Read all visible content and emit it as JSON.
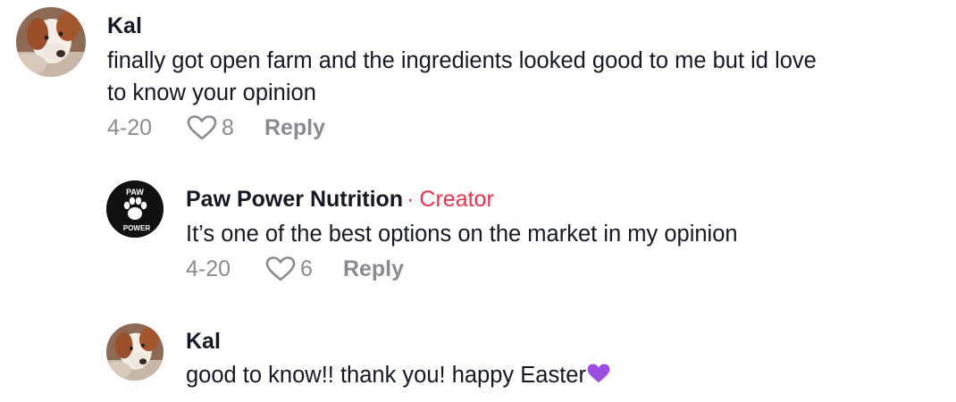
{
  "comments": [
    {
      "username": "Kal",
      "text_line1": "finally got open farm and the ingredients looked good to me but id love",
      "text_line2": "to know your opinion",
      "date": "4-20",
      "likes": "8",
      "reply_label": "Reply",
      "avatar": "dog-avatar"
    },
    {
      "username": "Paw Power Nutrition",
      "separator": "·",
      "badge": "Creator",
      "text": "It’s one of the best options on the market in my opinion",
      "date": "4-20",
      "likes": "6",
      "reply_label": "Reply",
      "avatar": "paw-power-logo",
      "logo_text_top": "PAW",
      "logo_text_bottom": "POWER"
    },
    {
      "username": "Kal",
      "text": "good to know!! thank you! happy Easter",
      "emoji": "purple-heart",
      "avatar": "dog-avatar"
    }
  ],
  "colors": {
    "creator": "#e8334f",
    "meta": "#8a8b91",
    "text": "#161823",
    "purple_heart": "#9b4de0"
  }
}
